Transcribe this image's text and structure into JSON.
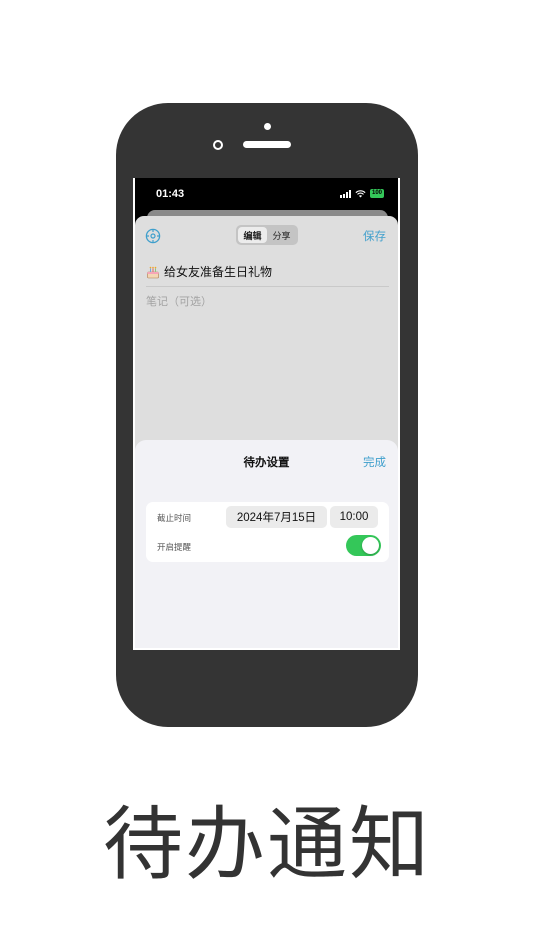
{
  "status_bar": {
    "time": "01:43",
    "battery": "100"
  },
  "nav": {
    "segments": [
      "编辑",
      "分享"
    ],
    "active_segment": "编辑",
    "save_label": "保存"
  },
  "todo": {
    "title": "给女友准备生日礼物",
    "title_icon": "birthday-cake-icon",
    "notes_placeholder": "笔记（可选）"
  },
  "settings_panel": {
    "title": "待办设置",
    "done_label": "完成",
    "deadline_label": "截止时间",
    "deadline_date": "2024年7月15日",
    "deadline_time": "10:00",
    "reminder_label": "开启提醒",
    "reminder_enabled": true
  },
  "caption": "待办通知",
  "colors": {
    "accent": "#3f9fcc",
    "toggle_on": "#34c759",
    "phone_body": "#343434"
  }
}
